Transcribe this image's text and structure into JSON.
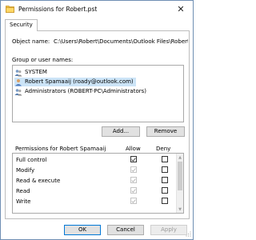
{
  "window": {
    "title": "Permissions for Robert.pst",
    "close_glyph": "✕"
  },
  "tabs": [
    {
      "label": "Security",
      "active": true
    }
  ],
  "object": {
    "label": "Object name:",
    "value": "C:\\Users\\Robert\\Documents\\Outlook Files\\Robert"
  },
  "groups": {
    "label": "Group or user names:",
    "items": [
      {
        "label": "SYSTEM",
        "icon": "group-users-icon",
        "selected": false
      },
      {
        "label": "Robert Spamaaij (roady@outlook.com)",
        "icon": "user-icon",
        "selected": true
      },
      {
        "label": "Administrators (ROBERT-PC\\Administrators)",
        "icon": "group-users-icon",
        "selected": false
      }
    ]
  },
  "buttons": {
    "add": "Add...",
    "remove": "Remove",
    "ok": "OK",
    "cancel": "Cancel",
    "apply": "Apply"
  },
  "permissions": {
    "header": "Permissions for Robert Spamaaij",
    "allow_label": "Allow",
    "deny_label": "Deny",
    "rows": [
      {
        "name": "Full control",
        "allow": "checked",
        "deny": "unchecked"
      },
      {
        "name": "Modify",
        "allow": "checked-disabled",
        "deny": "unchecked"
      },
      {
        "name": "Read & execute",
        "allow": "checked-disabled",
        "deny": "unchecked"
      },
      {
        "name": "Read",
        "allow": "checked-disabled",
        "deny": "unchecked"
      },
      {
        "name": "Write",
        "allow": "checked-disabled",
        "deny": "unchecked"
      }
    ]
  },
  "colors": {
    "accent": "#0078d7",
    "selection": "#cce4f7",
    "border": "#bdbdbd"
  }
}
